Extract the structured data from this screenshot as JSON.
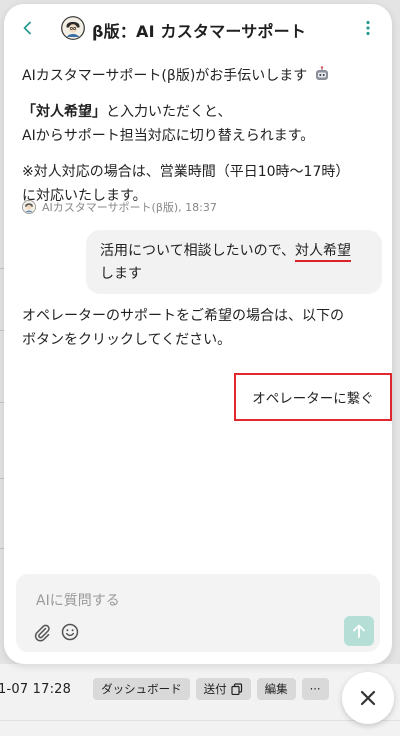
{
  "header": {
    "title": "β版：AI カスタマーサポート"
  },
  "bot_message": {
    "line1": "AIカスタマーサポート(β版)がお手伝いします",
    "line2_bold": "「対人希望」",
    "line2_rest": "と入力いただくと、",
    "line3": "AIからサポート担当対応に切り替えられます。",
    "line4": "※対人対応の場合は、営業時間（平日10時〜17時）",
    "line5": "に対応いたします。"
  },
  "bot_meta": {
    "sender": "AIカスタマーサポート(β版), 18:37"
  },
  "user_message": {
    "text_before": "活用について相談したいので、",
    "text_highlight": "対人希望",
    "text_after": "します"
  },
  "bot_message2": {
    "line1": "オペレーターのサポートをご希望の場合は、以下の",
    "line2": "ボタンをクリックしてください。"
  },
  "operator_button": {
    "label": "オペレーターに繋ぐ"
  },
  "composer": {
    "placeholder": "AIに質問する"
  },
  "background": {
    "date": "1-07 17:28",
    "dashboard_label": "ダッシュボード",
    "send_label": "送付",
    "edit_label": "編集",
    "more_label": "···"
  },
  "colors": {
    "accent": "#2a9d8f",
    "highlight_red": "#e0282e",
    "send_disabled": "#b4ded6"
  },
  "icons": [
    "back-icon",
    "avatar-icon",
    "more-vertical-icon",
    "robot-icon",
    "attach-icon",
    "emoji-icon",
    "send-arrow-icon",
    "close-icon",
    "copy-icon"
  ]
}
